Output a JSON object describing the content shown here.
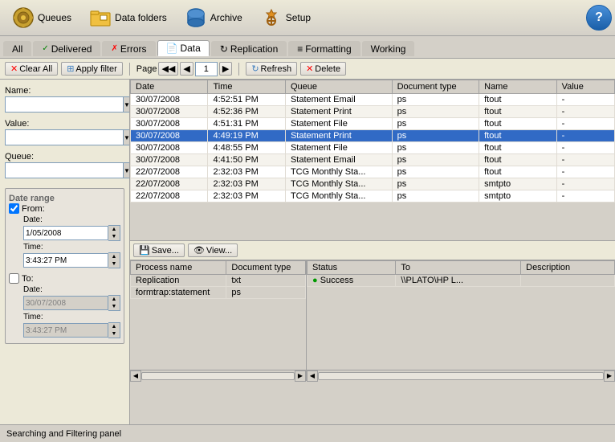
{
  "toolbar": {
    "items": [
      {
        "id": "queues",
        "label": "Queues",
        "icon": "⚙"
      },
      {
        "id": "data-folders",
        "label": "Data folders",
        "icon": "📁"
      },
      {
        "id": "archive",
        "label": "Archive",
        "icon": "💾"
      },
      {
        "id": "setup",
        "label": "Setup",
        "icon": "🔧"
      }
    ],
    "help_label": "?"
  },
  "nav_tabs": [
    {
      "id": "all",
      "label": "All",
      "icon": "",
      "active": false
    },
    {
      "id": "delivered",
      "label": "Delivered",
      "icon": "✓",
      "active": false
    },
    {
      "id": "errors",
      "label": "Errors",
      "icon": "✗",
      "active": false
    },
    {
      "id": "data",
      "label": "Data",
      "icon": "📄",
      "active": true
    },
    {
      "id": "replication",
      "label": "Replication",
      "icon": "↻",
      "active": false
    },
    {
      "id": "formatting",
      "label": "Formatting",
      "icon": "≡",
      "active": false
    },
    {
      "id": "working",
      "label": "Working",
      "icon": "",
      "active": false
    }
  ],
  "action_bar": {
    "clear_all": "Clear All",
    "apply_filter": "Apply filter",
    "page_label": "Page",
    "page_first": "◀◀",
    "page_prev": "◀",
    "page_num": "1",
    "page_next": "▶",
    "refresh": "Refresh",
    "delete": "Delete"
  },
  "filter": {
    "name_label": "Name:",
    "value_label": "Value:",
    "queue_label": "Queue:",
    "date_range_title": "Date range",
    "from_label": "From:",
    "from_checked": true,
    "from_date": "1/05/2008",
    "from_time": "3:43:27 PM",
    "to_label": "To:",
    "to_checked": false,
    "to_date": "30/07/2008",
    "to_time": "3:43:27 PM"
  },
  "table": {
    "columns": [
      "Date",
      "Time",
      "Queue",
      "Document type",
      "Name",
      "Value"
    ],
    "rows": [
      {
        "date": "30/07/2008",
        "time": "4:52:51 PM",
        "queue": "Statement Email",
        "doc_type": "ps",
        "name": "ftout",
        "value": "-",
        "selected": false
      },
      {
        "date": "30/07/2008",
        "time": "4:52:36 PM",
        "queue": "Statement Print",
        "doc_type": "ps",
        "name": "ftout",
        "value": "-",
        "selected": false
      },
      {
        "date": "30/07/2008",
        "time": "4:51:31 PM",
        "queue": "Statement File",
        "doc_type": "ps",
        "name": "ftout",
        "value": "-",
        "selected": false
      },
      {
        "date": "30/07/2008",
        "time": "4:49:19 PM",
        "queue": "Statement Print",
        "doc_type": "ps",
        "name": "ftout",
        "value": "-",
        "selected": true
      },
      {
        "date": "30/07/2008",
        "time": "4:48:55 PM",
        "queue": "Statement File",
        "doc_type": "ps",
        "name": "ftout",
        "value": "-",
        "selected": false
      },
      {
        "date": "30/07/2008",
        "time": "4:41:50 PM",
        "queue": "Statement Email",
        "doc_type": "ps",
        "name": "ftout",
        "value": "-",
        "selected": false
      },
      {
        "date": "22/07/2008",
        "time": "2:32:03 PM",
        "queue": "TCG Monthly Sta...",
        "doc_type": "ps",
        "name": "ftout",
        "value": "-",
        "selected": false
      },
      {
        "date": "22/07/2008",
        "time": "2:32:03 PM",
        "queue": "TCG Monthly Sta...",
        "doc_type": "ps",
        "name": "smtpto",
        "value": "-",
        "selected": false
      },
      {
        "date": "22/07/2008",
        "time": "2:32:03 PM",
        "queue": "TCG Monthly Sta...",
        "doc_type": "ps",
        "name": "smtpto",
        "value": "-",
        "selected": false
      }
    ]
  },
  "bottom": {
    "save_label": "Save...",
    "view_label": "View...",
    "process_cols": [
      "Process name",
      "Document type"
    ],
    "process_rows": [
      {
        "name": "Replication",
        "doc_type": "txt"
      },
      {
        "name": "formtrap:statement",
        "doc_type": "ps"
      }
    ],
    "status_cols": [
      "Status",
      "To",
      "Description"
    ],
    "status_rows": [
      {
        "status": "Success",
        "to": "\\\\PLATO\\HP L...",
        "description": ""
      }
    ]
  },
  "status_bar": {
    "text": "Searching and Filtering panel"
  }
}
